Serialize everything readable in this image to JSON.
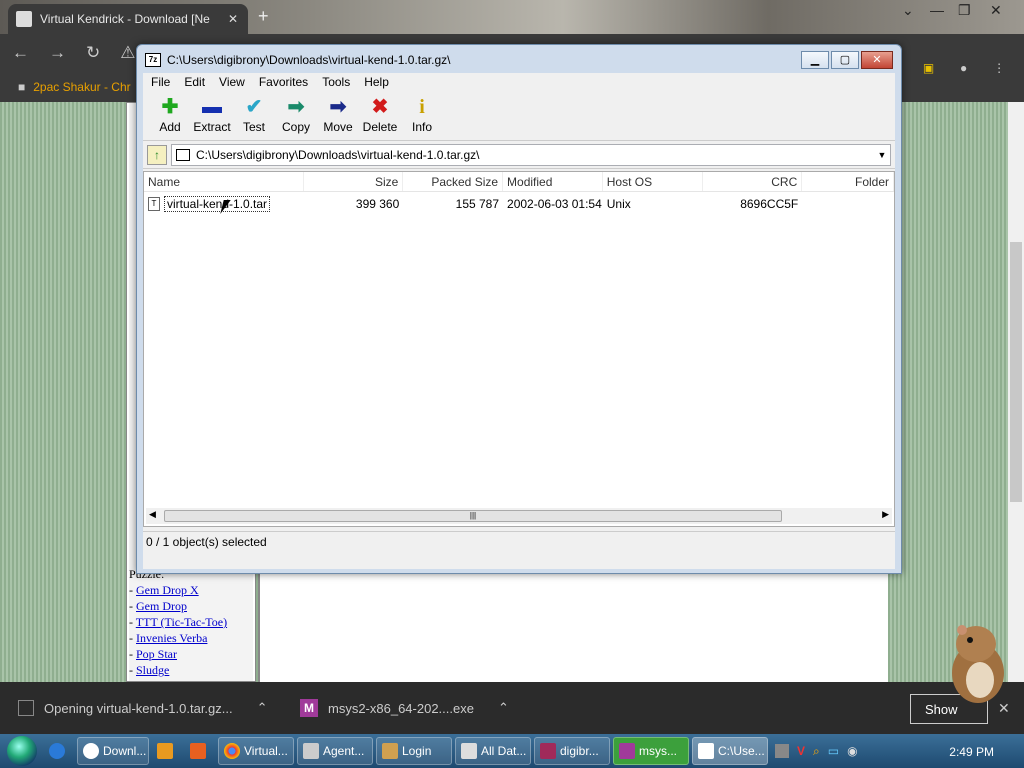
{
  "browser": {
    "tab_title": "Virtual Kendrick - Download [Ne",
    "bookmark": "2pac Shakur - Chr"
  },
  "page": {
    "section": "Puzzle:",
    "links": [
      "Gem Drop X",
      "Gem Drop",
      "TTT (Tic-Tac-Toe)",
      "Invenies Verba",
      "Pop Star",
      "Sludge"
    ]
  },
  "sevenzip": {
    "title": "C:\\Users\\digibrony\\Downloads\\virtual-kend-1.0.tar.gz\\",
    "menu": [
      "File",
      "Edit",
      "View",
      "Favorites",
      "Tools",
      "Help"
    ],
    "tools": [
      {
        "label": "Add",
        "icon": "add-icon",
        "color": "#1fa81f"
      },
      {
        "label": "Extract",
        "icon": "extract-icon",
        "color": "#1530b0"
      },
      {
        "label": "Test",
        "icon": "test-icon",
        "color": "#2aa6c8"
      },
      {
        "label": "Copy",
        "icon": "copy-icon",
        "color": "#1a8a6a"
      },
      {
        "label": "Move",
        "icon": "move-icon",
        "color": "#1a2a8a"
      },
      {
        "label": "Delete",
        "icon": "delete-icon",
        "color": "#d21b1b"
      },
      {
        "label": "Info",
        "icon": "info-icon",
        "color": "#c8a000"
      }
    ],
    "address": "C:\\Users\\digibrony\\Downloads\\virtual-kend-1.0.tar.gz\\",
    "columns": [
      "Name",
      "Size",
      "Packed Size",
      "Modified",
      "Host OS",
      "CRC",
      "Folder"
    ],
    "files": [
      {
        "name": "virtual-kend-1.0.tar",
        "size": "399 360",
        "packed": "155 787",
        "modified": "2002-06-03 01:54",
        "host": "Unix",
        "crc": "8696CC5F",
        "folder": ""
      }
    ],
    "status": "0 / 1 object(s) selected"
  },
  "downloads": [
    {
      "name": "Opening virtual-kend-1.0.tar.gz..."
    },
    {
      "name": "msys2-x86_64-202....exe"
    }
  ],
  "downloads_show": "Show",
  "taskbar": {
    "items": [
      "Downl...",
      "Virtual...",
      "Agent...",
      "Login",
      "All Dat...",
      "digibr...",
      "msys...",
      "C:\\Use..."
    ],
    "clock": "2:49 PM"
  }
}
